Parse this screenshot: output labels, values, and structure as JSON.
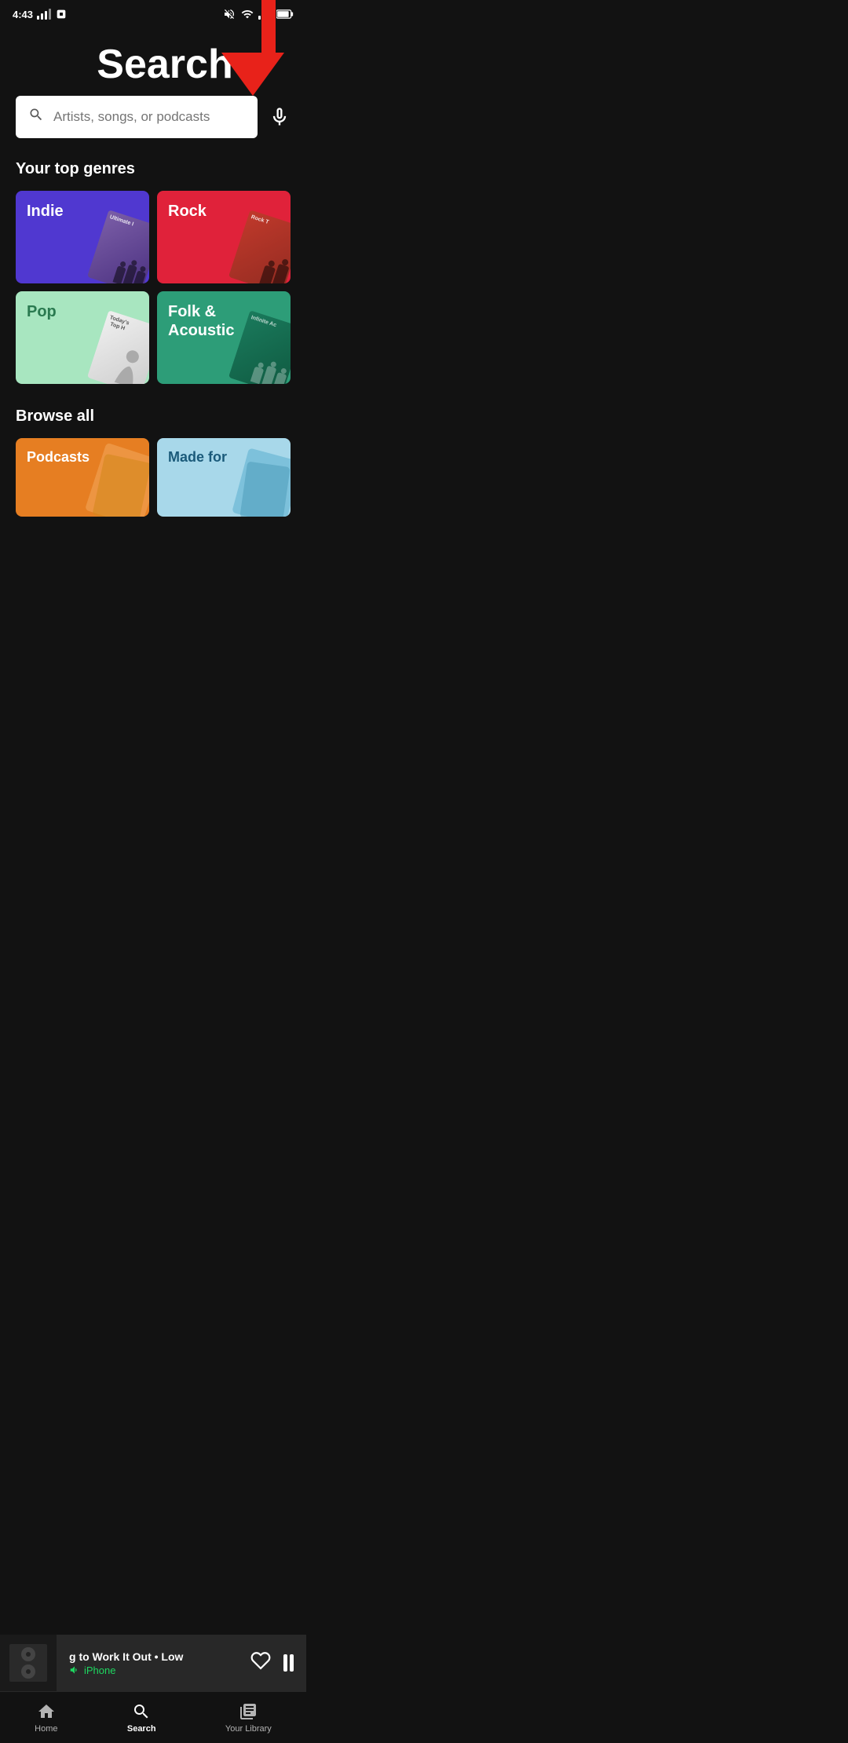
{
  "statusBar": {
    "time": "4:43",
    "muted": true
  },
  "header": {
    "title": "Search"
  },
  "searchBar": {
    "placeholder": "Artists, songs, or podcasts"
  },
  "sections": {
    "topGenres": {
      "label": "Your top genres",
      "genres": [
        {
          "id": "indie",
          "label": "Indie",
          "color": "#5038d0",
          "artText": "Ultimate I"
        },
        {
          "id": "rock",
          "label": "Rock",
          "color": "#e0223a",
          "artText": "Rock T"
        },
        {
          "id": "pop",
          "label": "Pop",
          "color": "#a8e6c0",
          "artText": "Today's\nTop H"
        },
        {
          "id": "folk",
          "label": "Folk &\nAcoustic",
          "color": "#2d9d78",
          "artText": "Infinite Ac"
        }
      ]
    },
    "browseAll": {
      "label": "Browse all",
      "categories": [
        {
          "id": "podcasts",
          "label": "Podcasts",
          "color": "#e67e22"
        },
        {
          "id": "made-for",
          "label": "Made for",
          "color": "#a8d8ea"
        }
      ]
    }
  },
  "nowPlaying": {
    "title": "g to Work It Out • Low",
    "device": "iPhone",
    "liked": false
  },
  "bottomNav": {
    "items": [
      {
        "id": "home",
        "label": "Home",
        "active": false
      },
      {
        "id": "search",
        "label": "Search",
        "active": true
      },
      {
        "id": "library",
        "label": "Your Library",
        "active": false
      }
    ]
  },
  "androidNav": {
    "buttons": [
      "|||",
      "○",
      "‹"
    ]
  }
}
